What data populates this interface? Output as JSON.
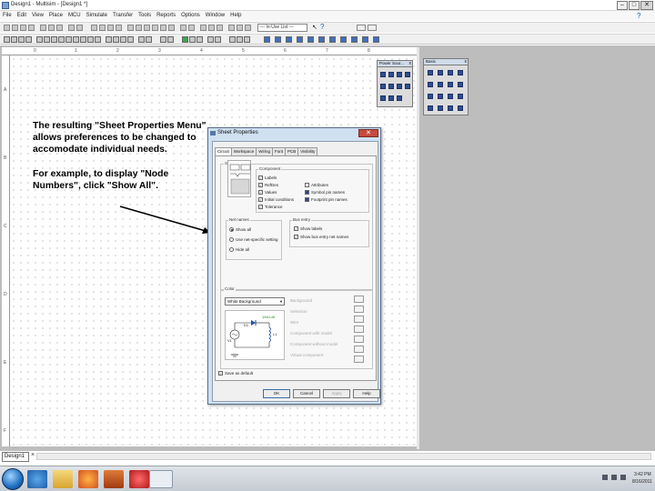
{
  "window": {
    "title": "Design1 - Multisim - [Design1 *]",
    "min": "–",
    "max": "□",
    "close": "✕"
  },
  "menu": {
    "items": [
      "File",
      "Edit",
      "View",
      "Place",
      "MCU",
      "Simulate",
      "Transfer",
      "Tools",
      "Reports",
      "Options",
      "Window",
      "Help"
    ],
    "help_glyph": "?"
  },
  "toolbar": {
    "series_select": "--- In-Use List ---",
    "cursor_glyph": "↖",
    "help_glyph": "?"
  },
  "rulers": {
    "top": [
      "0",
      "1",
      "2",
      "3",
      "4",
      "5",
      "6",
      "7",
      "8"
    ],
    "left": [
      "A",
      "B",
      "C",
      "D",
      "E",
      "F"
    ]
  },
  "palettes": {
    "power": {
      "title": "Power Sour...",
      "close": "x"
    },
    "basic": {
      "title": "Basic",
      "close": "x"
    }
  },
  "callout": {
    "para1": "The resulting \"Sheet Properties Menu\"\nallows preferences to be changed to\naccomodate individual needs.",
    "para2": "For example, to display \"Node\nNumbers\", click \"Show All\"."
  },
  "dialog": {
    "title": "Sheet Properties",
    "close": "✕",
    "tabs": [
      "Circuit",
      "Workspace",
      "Wiring",
      "Font",
      "PCB",
      "Visibility"
    ],
    "show_label": "Show",
    "component": {
      "label": "Component",
      "items": [
        {
          "label": "Labels",
          "checked": true
        },
        {
          "label": "RefDes",
          "checked": true
        },
        {
          "label": "Values",
          "checked": true
        },
        {
          "label": "Initial conditions",
          "checked": true
        },
        {
          "label": "Tolerance",
          "checked": true
        }
      ],
      "items_right": [
        {
          "label": "Attributes",
          "checked": false
        },
        {
          "label": "Symbol pin names",
          "checked": true
        },
        {
          "label": "Footprint pin names",
          "checked": true
        }
      ]
    },
    "net_names": {
      "label": "Net names",
      "options": [
        {
          "label": "Show all",
          "selected": true
        },
        {
          "label": "Use net-specific setting",
          "selected": false
        },
        {
          "label": "Hide all",
          "selected": false
        }
      ]
    },
    "bus_entry": {
      "label": "Bus entry",
      "items": [
        {
          "label": "Show labels",
          "checked": true
        },
        {
          "label": "Show bus entry net names",
          "checked": true
        }
      ]
    },
    "color": {
      "label": "Color",
      "scheme": "White Background",
      "items": [
        "Background",
        "Selection",
        "Wire",
        "Component with model",
        "Component without model",
        "Virtual component"
      ]
    },
    "preview_labels": {
      "ref": "D1",
      "part": "1N4148",
      "v": "V1",
      "l": "L1"
    },
    "save_default": {
      "label": "Save as default",
      "checked": true
    },
    "buttons": {
      "ok": "OK",
      "cancel": "Cancel",
      "apply": "Apply",
      "help": "Help"
    }
  },
  "statusbar": {
    "sheet_tab": "Design1",
    "sheet_close": "×"
  },
  "taskbar": {
    "time": "3:42 PM",
    "date": "8/16/2011"
  }
}
